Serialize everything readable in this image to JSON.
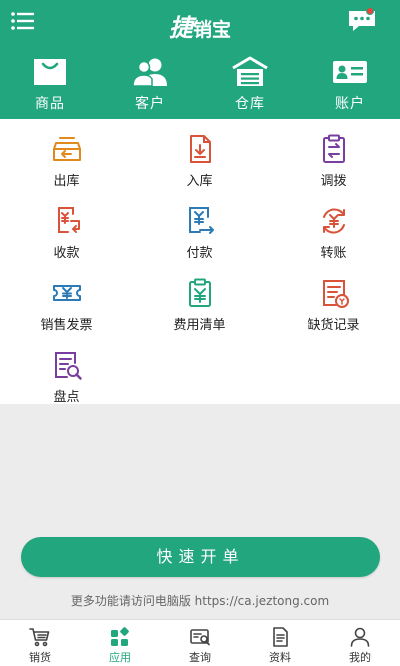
{
  "header": {
    "brand_mark": "捷",
    "brand_text": "销宝"
  },
  "top_nav": [
    {
      "label": "商品",
      "icon": "shopping-bag-icon"
    },
    {
      "label": "客户",
      "icon": "customers-icon"
    },
    {
      "label": "仓库",
      "icon": "warehouse-icon"
    },
    {
      "label": "账户",
      "icon": "account-card-icon"
    }
  ],
  "apps": [
    {
      "label": "出库",
      "icon": "stock-out-icon",
      "color": "#e08a1e"
    },
    {
      "label": "入库",
      "icon": "stock-in-icon",
      "color": "#d9533a"
    },
    {
      "label": "调拨",
      "icon": "transfer-clipboard-icon",
      "color": "#7a3f9e"
    },
    {
      "label": "收款",
      "icon": "receive-payment-icon",
      "color": "#d9533a"
    },
    {
      "label": "付款",
      "icon": "make-payment-icon",
      "color": "#2c7bb6"
    },
    {
      "label": "转账",
      "icon": "transfer-money-icon",
      "color": "#d9533a"
    },
    {
      "label": "销售发票",
      "icon": "sales-invoice-icon",
      "color": "#2c7bb6"
    },
    {
      "label": "费用清单",
      "icon": "expense-list-icon",
      "color": "#21a67e"
    },
    {
      "label": "缺货记录",
      "icon": "shortage-record-icon",
      "color": "#d9533a"
    },
    {
      "label": "盘点",
      "icon": "inventory-check-icon",
      "color": "#7a3f9e"
    }
  ],
  "quick_order": {
    "label": "快速开单"
  },
  "promo": {
    "text": "更多功能请访问电脑版 https://ca.jeztong.com"
  },
  "tabbar": [
    {
      "label": "销货",
      "icon": "cart-icon",
      "active": false
    },
    {
      "label": "应用",
      "icon": "apps-icon",
      "active": true
    },
    {
      "label": "查询",
      "icon": "query-icon",
      "active": false
    },
    {
      "label": "资料",
      "icon": "document-icon",
      "active": false
    },
    {
      "label": "我的",
      "icon": "profile-icon",
      "active": false
    }
  ],
  "colors": {
    "brand": "#21a67e",
    "background": "#ececec",
    "badge": "#e8453c"
  }
}
